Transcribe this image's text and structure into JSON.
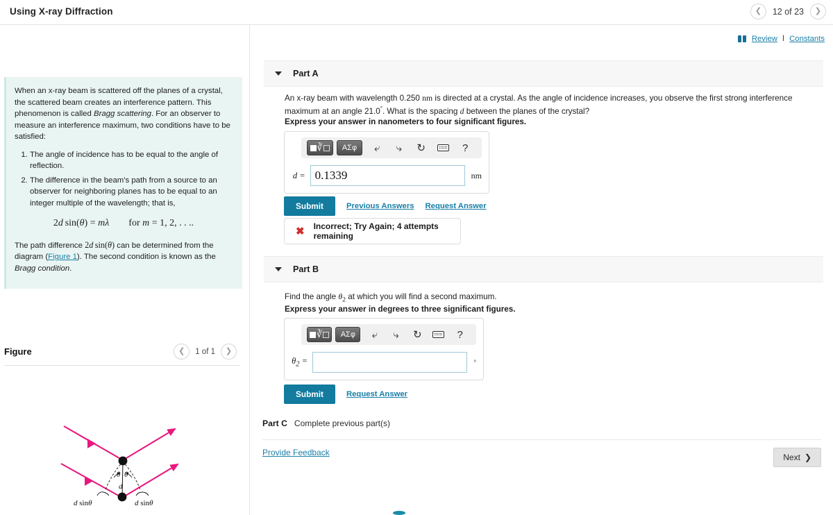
{
  "header": {
    "title": "Using X-ray Diffraction",
    "pager": {
      "prev_icon": "chevron-left-icon",
      "label": "12 of 23",
      "next_icon": "chevron-right-icon"
    }
  },
  "toolbar": {
    "book_icon": "book-icon",
    "review_label": "Review",
    "separator": "I",
    "constants_label": "Constants"
  },
  "left_pane": {
    "intro": {
      "para1_a": "When an x-ray beam is scattered off the planes of a crystal, the scattered beam creates an interference pattern. This phenomenon is called ",
      "para1_em": "Bragg scattering",
      "para1_b": ". For an observer to measure an interference maximum, two conditions have to be satisfied:",
      "item1": "The angle of incidence has to be equal to the angle of reflection.",
      "item2": "The difference in the beam's path from a source to an observer for neighboring planes has to be equal to an integer multiple of the wavelength; that is,",
      "equation_left": "2d sin(θ) = mλ",
      "equation_right": "for m = 1, 2, . . ..",
      "para2_a": "The path difference ",
      "para2_math": "2d sin(θ)",
      "para2_b": " can be determined from the diagram (",
      "figure_link": "Figure 1",
      "para2_c": "). The second condition is known as the ",
      "para2_em": "Bragg condition",
      "para2_d": "."
    },
    "figure": {
      "title": "Figure",
      "pager": {
        "prev_icon": "chevron-left-icon",
        "label": "1 of 1",
        "next_icon": "chevron-right-icon"
      },
      "diagram": {
        "ray_color": "#e8187f",
        "angle_label_left": "θ",
        "angle_label_right": "θ",
        "spacing_label": "d",
        "path_label_left": "d sinθ",
        "path_label_right": "d sinθ"
      }
    }
  },
  "parts": [
    {
      "id": "part-a",
      "caret_icon": "caret-down-icon",
      "label": "Part A",
      "question_a": "An x-ray beam with wavelength 0.250 ",
      "question_nm": "nm",
      "question_b": " is directed at a crystal. As the angle of incidence increases, you observe the first strong interference maximum at an angle 21.0",
      "question_deg": "°",
      "question_c": ". What is the spacing ",
      "question_d_var": "d",
      "question_d": " between the planes of the crystal?",
      "instruction": "Express your answer in nanometers to four significant figures.",
      "variable_label": "d =",
      "answer_value": "0.1339",
      "answer_placeholder": "",
      "unit": "nm",
      "submit_label": "Submit",
      "links": [
        "Previous Answers",
        "Request Answer"
      ],
      "feedback": {
        "icon": "x-mark-icon",
        "text": "Incorrect; Try Again; 4 attempts remaining"
      }
    },
    {
      "id": "part-b",
      "caret_icon": "caret-down-icon",
      "label": "Part B",
      "question_a": "Find the angle ",
      "question_theta": "θ2",
      "question_b": " at which you will find a second maximum.",
      "instruction": "Express your answer in degrees to three significant figures.",
      "variable_label": "θ2 =",
      "answer_value": "",
      "answer_placeholder": "",
      "unit": "°",
      "submit_label": "Submit",
      "links": [
        "Request Answer"
      ]
    }
  ],
  "math_toolbar": {
    "template_button": "sqrt-template-button",
    "symbols_button": "ΑΣφ",
    "undo_icon": "undo-icon",
    "redo_icon": "redo-icon",
    "reset_icon": "reset-icon",
    "keyboard_icon": "keyboard-icon",
    "help_icon": "help-icon",
    "help_label": "?"
  },
  "part_c": {
    "label": "Part C",
    "note": "Complete previous part(s)"
  },
  "footer": {
    "feedback_link": "Provide Feedback",
    "next_label": "Next",
    "next_icon": "chevron-right-icon"
  },
  "colors": {
    "accent": "#127b9e",
    "link": "#1a7fa8",
    "ray": "#e8187f",
    "error": "#d32b2b",
    "intro_bg": "#e9f5f3"
  }
}
